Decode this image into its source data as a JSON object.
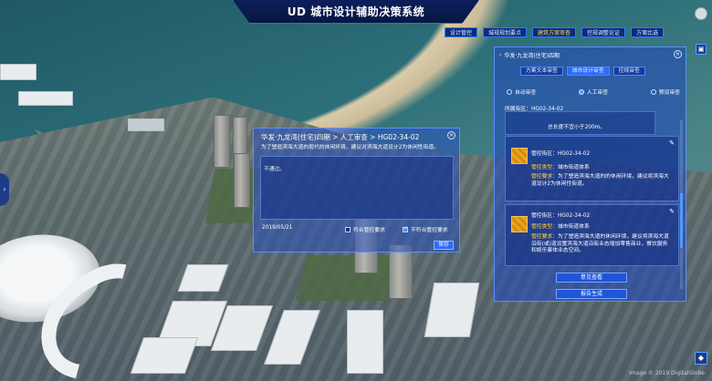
{
  "app": {
    "title": "UD 城市设计辅助决策系统"
  },
  "nav": [
    {
      "label": "设计管控",
      "active": false
    },
    {
      "label": "城规规划要点",
      "active": false
    },
    {
      "label": "建筑方案审查",
      "active": true
    },
    {
      "label": "控规调整论证",
      "active": false
    },
    {
      "label": "方案比选",
      "active": false
    }
  ],
  "dialog": {
    "title": "华发·九龙湾(住宅)四期  >  人工审查  >  HG02-34-02",
    "description": "为了塑造滨海大道的现代的休闲环境，建议对滨海大道设计2为休闲性街道。",
    "comment": "不通过。",
    "date": "2019/05/21",
    "options": [
      {
        "label": "符合管控要求",
        "checked": false
      },
      {
        "label": "不符合管控要求",
        "checked": true
      }
    ],
    "save": "保存",
    "close": "×"
  },
  "panel": {
    "title": "华发·九龙湾(住宅)四期",
    "close": "×",
    "tabs": [
      {
        "label": "方案文本审查",
        "active": false
      },
      {
        "label": "城市设计审查",
        "active": true
      },
      {
        "label": "控规审查",
        "active": false
      }
    ],
    "modes": [
      {
        "label": "自动审查",
        "selected": false
      },
      {
        "label": "人工审查",
        "selected": true
      },
      {
        "label": "预设审查",
        "selected": false
      }
    ],
    "zone_label": "所属街区：HG02-34-02",
    "note": "总长度不宜小于200m。",
    "cards": [
      {
        "zone": "管控街区：HG02-34-02",
        "type_key": "管控类型：",
        "type": "城市街道体系",
        "req_key": "管控要求：",
        "req": "为了塑造滨海大道的的休闲环境，建议将滨海大道设计2为休闲性街道。"
      },
      {
        "zone": "管控街区：HG02-34-02",
        "type_key": "管控类型：",
        "type": "城市街道体系",
        "req_key": "管控要求：",
        "req": "为了塑造滨海大道的休闲环境，建议将滨海大道沿街(或)道设置滨海大道沿街业态增加零售商业，餐饮服务和娱乐康体业态空间。"
      }
    ],
    "buttons": {
      "view": "意见查看",
      "report": "报告生成"
    }
  },
  "icons": {
    "compass": "compass-icon",
    "layers": "layers-icon",
    "left_toggle": "chevron-right-icon",
    "bottom_tool": "diamond-icon",
    "edit": "edit-icon",
    "back": "chevron-left-icon"
  },
  "watermark": "Image © 2019 DigitalGlobe"
}
